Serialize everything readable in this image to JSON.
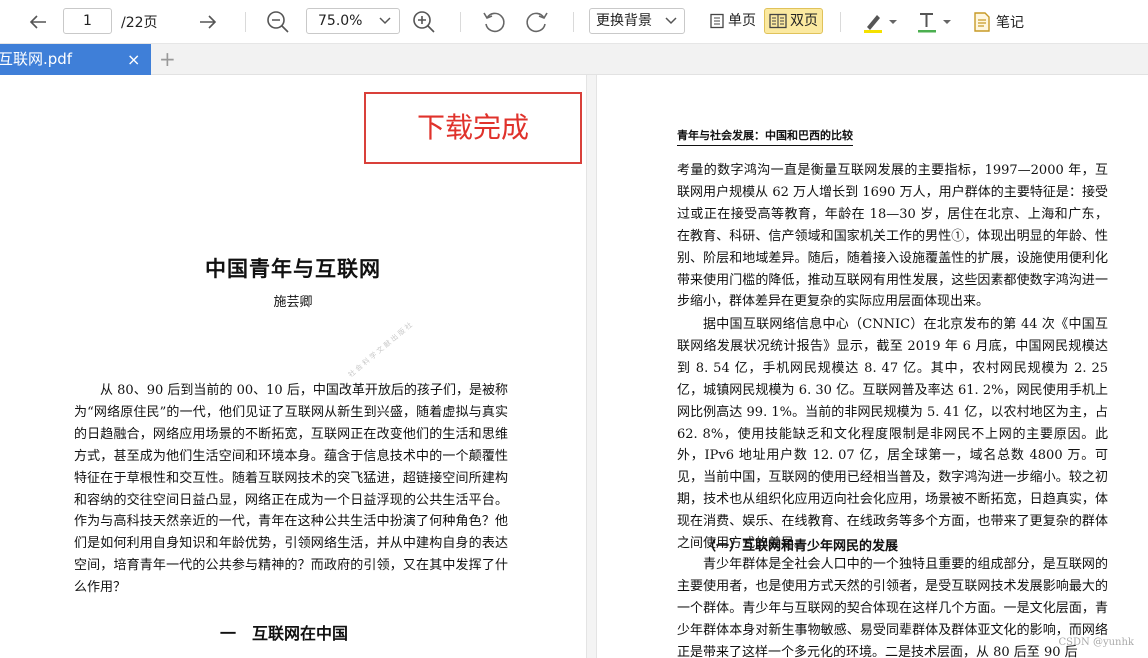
{
  "toolbar": {
    "current_page": "1",
    "total_pages": "/22页",
    "zoom_level": "75.0%",
    "background_label": "更换背景",
    "single_page_label": "单页",
    "double_page_label": "双页",
    "notes_label": "笔记",
    "highlight_color": "#f5e100",
    "text_color": "#4caf50",
    "active_view": "双页"
  },
  "tabs": [
    {
      "label": "互联网.pdf",
      "close": "×"
    }
  ],
  "tab_add": "+",
  "toast": {
    "message": "下载完成"
  },
  "left_page": {
    "title": "中国青年与互联网",
    "author": "施芸卿",
    "abstract": "从 80、90 后到当前的 00、10 后，中国改革开放后的孩子们，是被称为“网络原住民”的一代，他们见证了互联网从新生到兴盛，随着虚拟与真实的日趋融合，网络应用场景的不断拓宽，互联网正在改变他们的生活和思维方式，甚至成为他们生活空间和环境本身。蕴含于信息技术中的一个颠覆性特征在于草根性和交互性。随着互联网技术的突飞猛进，超链接空间所建构和容纳的交往空间日益凸显，网络正在成为一个日益浮现的公共生活平台。作为与高科技天然亲近的一代，青年在这种公共生活中扮演了何种角色？他们是如何利用自身知识和年龄优势，引领网络生活，并从中建构自身的表达空间，培育青年一代的公共参与精神的？而政府的引领，又在其中发挥了什么作用？",
    "section_heading": "一　互联网在中国"
  },
  "right_page": {
    "running_head": "青年与社会发展：中国和巴西的比较",
    "para1": "考量的数字鸿沟一直是衡量互联网发展的主要指标，1997—2000 年，互联网用户规模从 62 万人增长到 1690 万人，用户群体的主要特征是：接受过或正在接受高等教育，年龄在 18—30 岁，居住在北京、上海和广东，在教育、科研、信产领域和国家机关工作的男性①，体现出明显的年龄、性别、阶层和地域差异。随后，随着接入设施覆盖性的扩展，设施使用便利化带来使用门槛的降低，推动互联网有用性发展，这些因素都使数字鸿沟进一步缩小，群体差异在更复杂的实际应用层面体现出来。",
    "para2": "据中国互联网络信息中心（CNNIC）在北京发布的第 44 次《中国互联网络发展状况统计报告》显示，截至 2019 年 6 月底，中国网民规模达到 8. 54 亿，手机网民规模达 8. 47 亿。其中，农村网民规模为 2. 25 亿，城镇网民规模为 6. 30 亿。互联网普及率达 61. 2%，网民使用手机上网比例高达 99. 1%。当前的非网民规模为 5. 41 亿，以农村地区为主，占 62. 8%，使用技能缺乏和文化程度限制是非网民不上网的主要原因。此外，IPv6 地址用户数 12. 07 亿，居全球第一，域名总数 4800 万。可见，当前中国，互联网的使用已经相当普及，数字鸿沟进一步缩小。较之初期，技术也从组织化应用迈向社会化应用，场景被不断拓宽，日趋真实，体现在消费、娱乐、在线教育、在线政务等多个方面，也带来了更复杂的群体之间使用方式的差异。",
    "subheading": "（一）互联网和青少年网民的发展",
    "para3": "青少年群体是全社会人口中的一个独特且重要的组成部分，是互联网的主要使用者，也是使用方式天然的引领者，是受互联网技术发展影响最大的一个群体。青少年与互联网的契合体现在这样几个方面。一是文化层面，青少年群体本身对新生事物敏感、易受同辈群体及群体亚文化的影响，而网络正是带来了这样一个多元化的环境。二是技术层面，从 80 后至 90 后"
  },
  "credit": "CSDN @yunhk"
}
